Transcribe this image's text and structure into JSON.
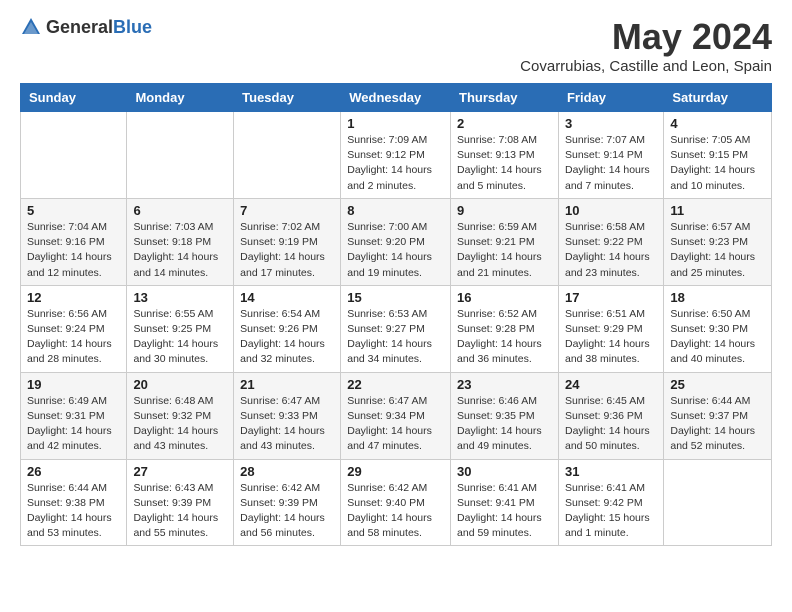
{
  "header": {
    "logo_general": "General",
    "logo_blue": "Blue",
    "month_title": "May 2024",
    "location": "Covarrubias, Castille and Leon, Spain"
  },
  "days_of_week": [
    "Sunday",
    "Monday",
    "Tuesday",
    "Wednesday",
    "Thursday",
    "Friday",
    "Saturday"
  ],
  "weeks": [
    [
      {
        "num": "",
        "info": ""
      },
      {
        "num": "",
        "info": ""
      },
      {
        "num": "",
        "info": ""
      },
      {
        "num": "1",
        "info": "Sunrise: 7:09 AM\nSunset: 9:12 PM\nDaylight: 14 hours\nand 2 minutes."
      },
      {
        "num": "2",
        "info": "Sunrise: 7:08 AM\nSunset: 9:13 PM\nDaylight: 14 hours\nand 5 minutes."
      },
      {
        "num": "3",
        "info": "Sunrise: 7:07 AM\nSunset: 9:14 PM\nDaylight: 14 hours\nand 7 minutes."
      },
      {
        "num": "4",
        "info": "Sunrise: 7:05 AM\nSunset: 9:15 PM\nDaylight: 14 hours\nand 10 minutes."
      }
    ],
    [
      {
        "num": "5",
        "info": "Sunrise: 7:04 AM\nSunset: 9:16 PM\nDaylight: 14 hours\nand 12 minutes."
      },
      {
        "num": "6",
        "info": "Sunrise: 7:03 AM\nSunset: 9:18 PM\nDaylight: 14 hours\nand 14 minutes."
      },
      {
        "num": "7",
        "info": "Sunrise: 7:02 AM\nSunset: 9:19 PM\nDaylight: 14 hours\nand 17 minutes."
      },
      {
        "num": "8",
        "info": "Sunrise: 7:00 AM\nSunset: 9:20 PM\nDaylight: 14 hours\nand 19 minutes."
      },
      {
        "num": "9",
        "info": "Sunrise: 6:59 AM\nSunset: 9:21 PM\nDaylight: 14 hours\nand 21 minutes."
      },
      {
        "num": "10",
        "info": "Sunrise: 6:58 AM\nSunset: 9:22 PM\nDaylight: 14 hours\nand 23 minutes."
      },
      {
        "num": "11",
        "info": "Sunrise: 6:57 AM\nSunset: 9:23 PM\nDaylight: 14 hours\nand 25 minutes."
      }
    ],
    [
      {
        "num": "12",
        "info": "Sunrise: 6:56 AM\nSunset: 9:24 PM\nDaylight: 14 hours\nand 28 minutes."
      },
      {
        "num": "13",
        "info": "Sunrise: 6:55 AM\nSunset: 9:25 PM\nDaylight: 14 hours\nand 30 minutes."
      },
      {
        "num": "14",
        "info": "Sunrise: 6:54 AM\nSunset: 9:26 PM\nDaylight: 14 hours\nand 32 minutes."
      },
      {
        "num": "15",
        "info": "Sunrise: 6:53 AM\nSunset: 9:27 PM\nDaylight: 14 hours\nand 34 minutes."
      },
      {
        "num": "16",
        "info": "Sunrise: 6:52 AM\nSunset: 9:28 PM\nDaylight: 14 hours\nand 36 minutes."
      },
      {
        "num": "17",
        "info": "Sunrise: 6:51 AM\nSunset: 9:29 PM\nDaylight: 14 hours\nand 38 minutes."
      },
      {
        "num": "18",
        "info": "Sunrise: 6:50 AM\nSunset: 9:30 PM\nDaylight: 14 hours\nand 40 minutes."
      }
    ],
    [
      {
        "num": "19",
        "info": "Sunrise: 6:49 AM\nSunset: 9:31 PM\nDaylight: 14 hours\nand 42 minutes."
      },
      {
        "num": "20",
        "info": "Sunrise: 6:48 AM\nSunset: 9:32 PM\nDaylight: 14 hours\nand 43 minutes."
      },
      {
        "num": "21",
        "info": "Sunrise: 6:47 AM\nSunset: 9:33 PM\nDaylight: 14 hours\nand 43 minutes."
      },
      {
        "num": "22",
        "info": "Sunrise: 6:47 AM\nSunset: 9:34 PM\nDaylight: 14 hours\nand 47 minutes."
      },
      {
        "num": "23",
        "info": "Sunrise: 6:46 AM\nSunset: 9:35 PM\nDaylight: 14 hours\nand 49 minutes."
      },
      {
        "num": "24",
        "info": "Sunrise: 6:45 AM\nSunset: 9:36 PM\nDaylight: 14 hours\nand 50 minutes."
      },
      {
        "num": "25",
        "info": "Sunrise: 6:44 AM\nSunset: 9:37 PM\nDaylight: 14 hours\nand 52 minutes."
      }
    ],
    [
      {
        "num": "26",
        "info": "Sunrise: 6:44 AM\nSunset: 9:38 PM\nDaylight: 14 hours\nand 53 minutes."
      },
      {
        "num": "27",
        "info": "Sunrise: 6:43 AM\nSunset: 9:39 PM\nDaylight: 14 hours\nand 55 minutes."
      },
      {
        "num": "28",
        "info": "Sunrise: 6:42 AM\nSunset: 9:39 PM\nDaylight: 14 hours\nand 56 minutes."
      },
      {
        "num": "29",
        "info": "Sunrise: 6:42 AM\nSunset: 9:40 PM\nDaylight: 14 hours\nand 58 minutes."
      },
      {
        "num": "30",
        "info": "Sunrise: 6:41 AM\nSunset: 9:41 PM\nDaylight: 14 hours\nand 59 minutes."
      },
      {
        "num": "31",
        "info": "Sunrise: 6:41 AM\nSunset: 9:42 PM\nDaylight: 15 hours\nand 1 minute."
      },
      {
        "num": "",
        "info": ""
      }
    ]
  ]
}
